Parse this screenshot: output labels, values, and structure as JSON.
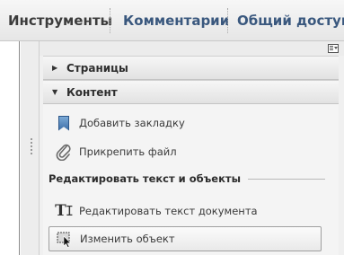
{
  "tabs": {
    "tools": "Инструменты",
    "comments": "Комментарии",
    "share": "Общий доступ"
  },
  "panel": {
    "sections": {
      "pages": "Страницы",
      "content": "Контент"
    },
    "content": {
      "add_bookmark": "Добавить закладку",
      "attach_file": "Прикрепить файл",
      "edit_group_title": "Редактировать текст и объекты",
      "edit_text": "Редактировать текст документа",
      "edit_object": "Изменить объект"
    }
  },
  "icons": {
    "options": "options-menu-icon",
    "bookmark": "bookmark-icon",
    "attach": "paperclip-icon",
    "edit_text": "text-cursor-icon",
    "edit_object": "object-select-icon"
  },
  "colors": {
    "tab_active_text": "#3c3c3c",
    "tab_link_text": "#3a587e",
    "bookmark_blue": "#3d6fa8"
  }
}
